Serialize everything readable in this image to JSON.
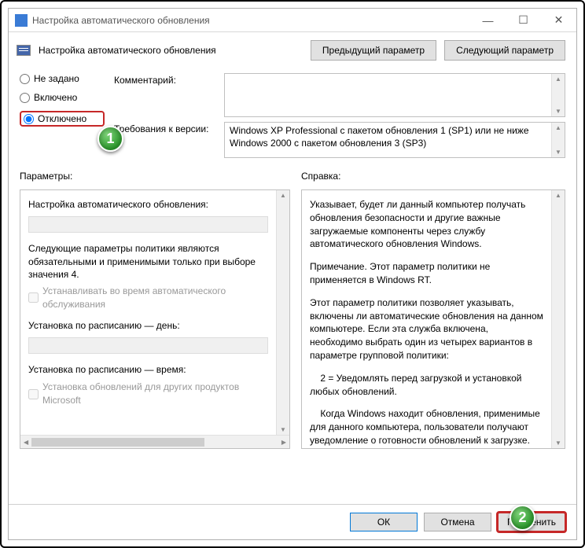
{
  "window_title": "Настройка автоматического обновления",
  "header_title": "Настройка автоматического обновления",
  "nav": {
    "prev": "Предыдущий параметр",
    "next": "Следующий параметр"
  },
  "radios": {
    "not_configured": "Не задано",
    "enabled": "Включено",
    "disabled": "Отключено"
  },
  "fields": {
    "comment_label": "Комментарий:",
    "requirements_label": "Требования к версии:",
    "requirements_text": "Windows XP Professional с пакетом обновления 1 (SP1) или не ниже Windows 2000 с пакетом обновления 3 (SP3)"
  },
  "columns": {
    "params": "Параметры:",
    "help": "Справка:"
  },
  "params": {
    "heading": "Настройка автоматического обновления:",
    "paragraph": "Следующие параметры политики являются обязательными и применимыми только при выборе значения 4.",
    "cb1": "Устанавливать во время автоматического обслуживания",
    "sched_day": "Установка по расписанию — день:",
    "sched_time": "Установка по расписанию — время:",
    "cb2": "Установка обновлений для других продуктов Microsoft"
  },
  "help": {
    "p1": "Указывает, будет ли данный компьютер получать обновления безопасности и другие важные загружаемые компоненты через службу автоматического обновления Windows.",
    "p2": "Примечание. Этот параметр политики не применяется в Windows RT.",
    "p3": "Этот параметр политики позволяет указывать, включены ли автоматические обновления на данном компьютере. Если эта служба включена, необходимо выбрать один из четырех вариантов в параметре групповой политики:",
    "p4": "    2 = Уведомлять перед загрузкой и установкой любых обновлений.",
    "p5": "    Когда Windows находит обновления, применимые для данного компьютера, пользователи получают уведомление о готовности обновлений к загрузке. После перехода в Центр обновления Windows пользователи могут загрузить и установ"
  },
  "footer": {
    "ok": "ОК",
    "cancel": "Отмена",
    "apply": "Применить"
  },
  "callouts": {
    "one": "1",
    "two": "2"
  }
}
